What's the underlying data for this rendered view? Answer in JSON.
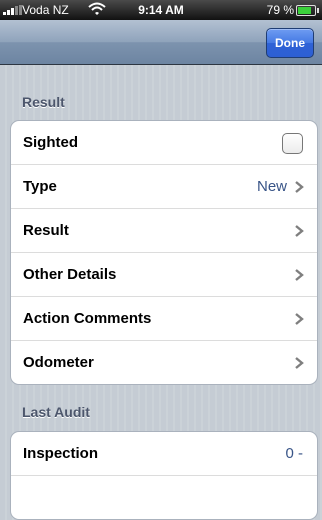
{
  "status": {
    "carrier": "Voda NZ",
    "time": "9:14 AM",
    "battery": "79 %",
    "battery_level": 0.79
  },
  "navbar": {
    "done_label": "Done"
  },
  "sections": [
    {
      "header": "Result",
      "rows": [
        {
          "label": "Sighted",
          "value": "",
          "accessory": "checkbox",
          "checked": false
        },
        {
          "label": "Type",
          "value": "New",
          "accessory": "chevron"
        },
        {
          "label": "Result",
          "value": "",
          "accessory": "chevron"
        },
        {
          "label": "Other Details",
          "value": "",
          "accessory": "chevron"
        },
        {
          "label": "Action Comments",
          "value": "",
          "accessory": "chevron"
        },
        {
          "label": "Odometer",
          "value": "",
          "accessory": "chevron"
        }
      ]
    },
    {
      "header": "Last Audit",
      "rows": [
        {
          "label": "Inspection",
          "value": "0 -",
          "accessory": "none"
        },
        {
          "label": "",
          "value": "",
          "accessory": "none"
        }
      ]
    }
  ]
}
